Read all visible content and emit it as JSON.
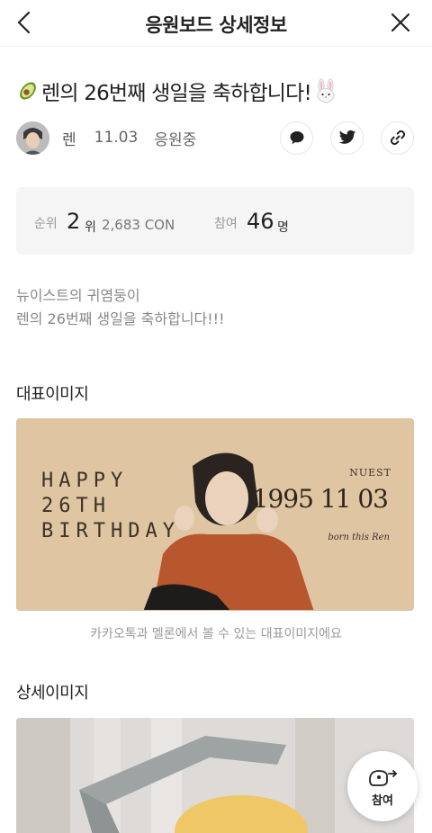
{
  "header": {
    "title": "응원보드 상세정보",
    "back_icon": "chevron-left-icon",
    "close_icon": "close-icon"
  },
  "board": {
    "title": "렌의 26번째 생일을 축하합니다!",
    "leading_emoji": "avocado",
    "trailing_emoji": "rabbit-face"
  },
  "meta": {
    "artist_name": "렌",
    "date": "11.03",
    "status": "응원중",
    "action_icons": [
      "chat-bubble-icon",
      "twitter-icon",
      "link-icon"
    ]
  },
  "stats": {
    "rank_label": "순위",
    "rank_value": "2",
    "rank_unit": "위",
    "con_value": "2,683 CON",
    "participants_label": "참여",
    "participants_value": "46",
    "participants_unit": "명"
  },
  "description": {
    "line1": "뉴이스트의 귀염둥이",
    "line2": "렌의 26번째 생일을 축하합니다!!!"
  },
  "representative": {
    "section_title": "대표이미지",
    "caption": "카카오톡과 멜론에서 볼 수 있는 대표이미지에요",
    "image_text": {
      "line1": "HAPPY",
      "line2": "26TH",
      "line3": "BIRTHDAY",
      "group": "NUEST",
      "date": "1995 11 03",
      "tagline": "born this Ren"
    }
  },
  "detail": {
    "section_title": "상세이미지"
  },
  "fab": {
    "label": "참여",
    "icon": "cheer-hand-icon"
  },
  "colors": {
    "rep_image_bg": "#dfc5a2",
    "accent_text": "#222222",
    "muted_text": "#888888"
  }
}
